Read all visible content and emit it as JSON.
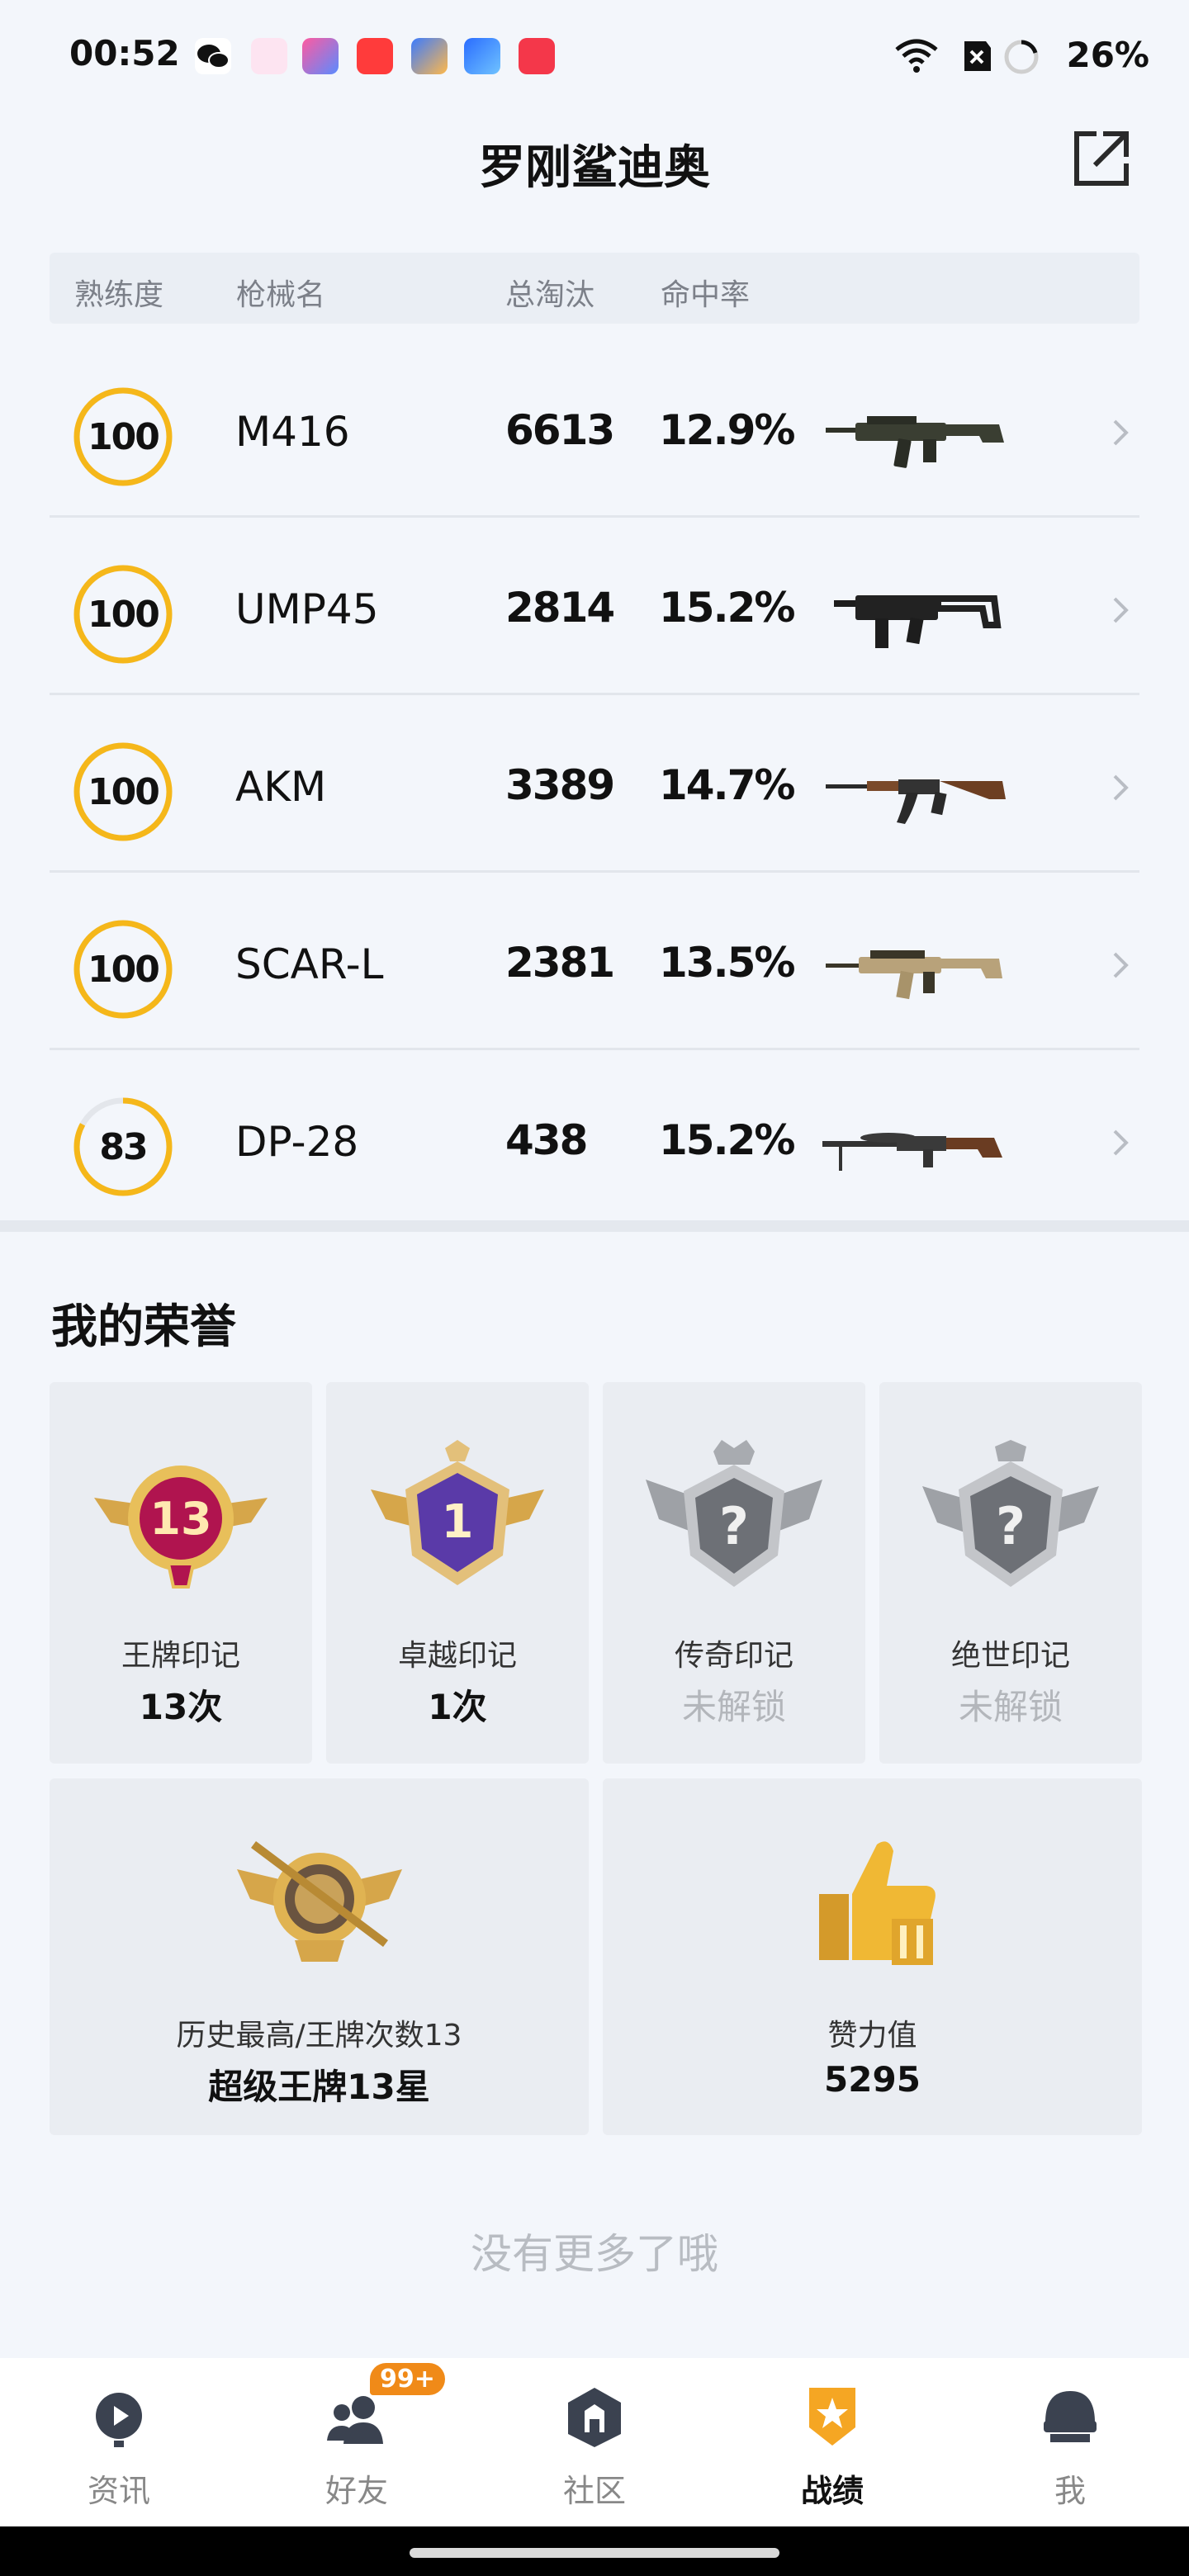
{
  "status_bar": {
    "time": "00:52",
    "battery": "26%"
  },
  "header": {
    "title": "罗刚鲨迪奥"
  },
  "table": {
    "headers": [
      "熟练度",
      "枪械名",
      "总淘汰",
      "命中率"
    ],
    "rows": [
      {
        "mastery": "100",
        "mastery_level": 1.0,
        "name": "M416",
        "kills": "6613",
        "accuracy": "12.9%"
      },
      {
        "mastery": "100",
        "mastery_level": 1.0,
        "name": "UMP45",
        "kills": "2814",
        "accuracy": "15.2%"
      },
      {
        "mastery": "100",
        "mastery_level": 1.0,
        "name": "AKM",
        "kills": "3389",
        "accuracy": "14.7%"
      },
      {
        "mastery": "100",
        "mastery_level": 1.0,
        "name": "SCAR-L",
        "kills": "2381",
        "accuracy": "13.5%"
      },
      {
        "mastery": "83",
        "mastery_level": 0.83,
        "name": "DP-28",
        "kills": "438",
        "accuracy": "15.2%"
      }
    ]
  },
  "honors": {
    "title": "我的荣誉",
    "marks": [
      {
        "label": "王牌印记",
        "value": "13次",
        "badge_number": "13",
        "locked": false
      },
      {
        "label": "卓越印记",
        "value": "1次",
        "badge_number": "1",
        "locked": false
      },
      {
        "label": "传奇印记",
        "value": "未解锁",
        "badge_number": "?",
        "locked": true
      },
      {
        "label": "绝世印记",
        "value": "未解锁",
        "badge_number": "?",
        "locked": true
      }
    ],
    "highest": {
      "label": "历史最高/王牌次数13",
      "value": "超级王牌13星"
    },
    "likes": {
      "label": "赞力值",
      "value": "5295"
    }
  },
  "footer_text": "没有更多了哦",
  "bottom_nav": {
    "items": [
      {
        "label": "资讯",
        "icon": "news-icon",
        "active": false
      },
      {
        "label": "好友",
        "icon": "friends-icon",
        "active": false
      },
      {
        "label": "社区",
        "icon": "community-icon",
        "active": false
      },
      {
        "label": "战绩",
        "icon": "records-icon",
        "active": true
      },
      {
        "label": "我",
        "icon": "me-icon",
        "active": false
      }
    ],
    "friends_badge": "99+"
  },
  "colors": {
    "ring": "#f5b71a",
    "ring_track": "#e3e6eb",
    "accent_orange": "#f08a18",
    "active_nav": "#f5a623"
  }
}
